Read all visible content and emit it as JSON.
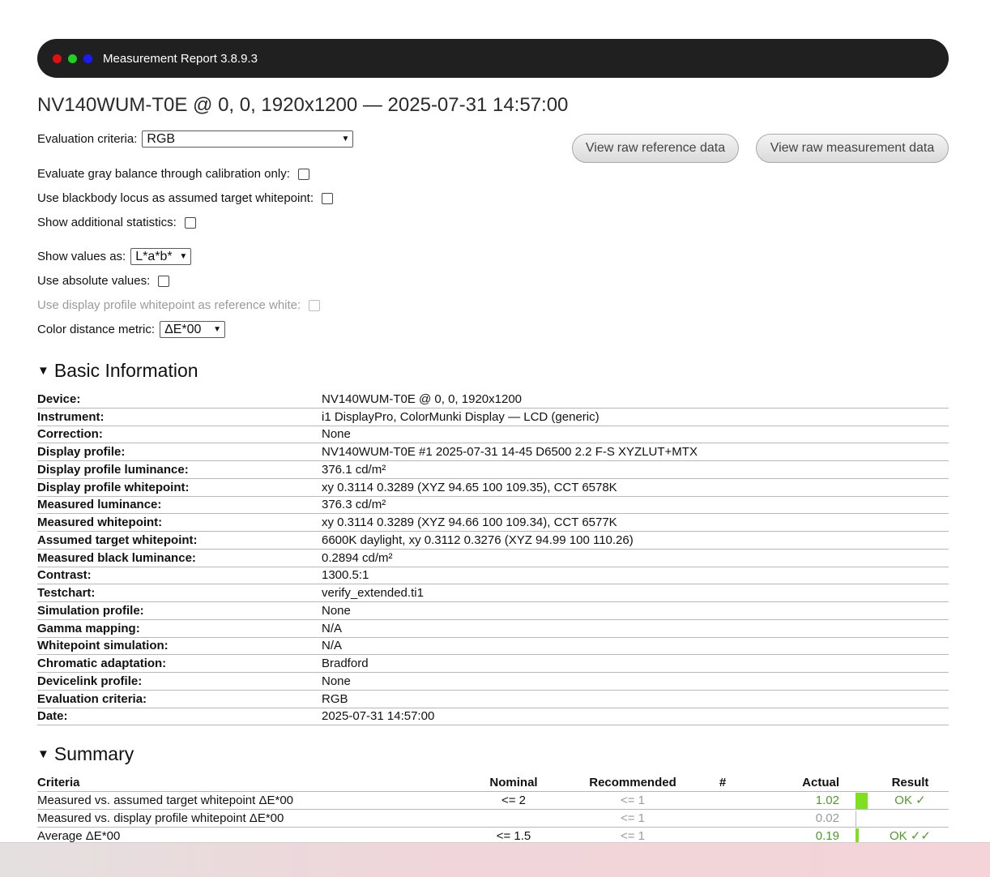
{
  "window": {
    "title": "Measurement Report 3.8.9.3",
    "dot_colors": [
      "#e01010",
      "#20d020",
      "#1a1aff"
    ]
  },
  "page_title": "NV140WUM-T0E @ 0, 0, 1920x1200 — 2025-07-31 14:57:00",
  "controls": {
    "evaluation_criteria": {
      "label": "Evaluation criteria:",
      "value": "RGB"
    },
    "gray_balance": {
      "label": "Evaluate gray balance through calibration only:"
    },
    "blackbody": {
      "label": "Use blackbody locus as assumed target whitepoint:"
    },
    "additional_stats": {
      "label": "Show additional statistics:"
    },
    "show_values": {
      "label": "Show values as:",
      "value": "L*a*b*"
    },
    "absolute_values": {
      "label": "Use absolute values:"
    },
    "profile_whitepoint": {
      "label": "Use display profile whitepoint as reference white:"
    },
    "distance_metric": {
      "label": "Color distance metric:",
      "value": "ΔE*00"
    }
  },
  "buttons": {
    "raw_reference": "View raw reference data",
    "raw_measurement": "View raw measurement data"
  },
  "basic_info": {
    "heading": "Basic Information",
    "rows": [
      {
        "label": "Device:",
        "value": "NV140WUM-T0E @ 0, 0, 1920x1200"
      },
      {
        "label": "Instrument:",
        "value": "i1 DisplayPro, ColorMunki Display — LCD (generic)"
      },
      {
        "label": "Correction:",
        "value": "None"
      },
      {
        "label": "Display profile:",
        "value": "NV140WUM-T0E #1 2025-07-31 14-45 D6500 2.2 F-S XYZLUT+MTX"
      },
      {
        "label": "Display profile luminance:",
        "value": "376.1 cd/m²"
      },
      {
        "label": "Display profile whitepoint:",
        "value": "xy 0.3114 0.3289 (XYZ 94.65 100 109.35), CCT 6578K"
      },
      {
        "label": "Measured luminance:",
        "value": "376.3 cd/m²"
      },
      {
        "label": "Measured whitepoint:",
        "value": "xy 0.3114 0.3289 (XYZ 94.66 100 109.34), CCT 6577K"
      },
      {
        "label": "Assumed target whitepoint:",
        "value": "6600K daylight, xy 0.3112 0.3276 (XYZ 94.99 100 110.26)"
      },
      {
        "label": "Measured black luminance:",
        "value": "0.2894 cd/m²"
      },
      {
        "label": "Contrast:",
        "value": "1300.5:1"
      },
      {
        "label": "Testchart:",
        "value": "verify_extended.ti1"
      },
      {
        "label": "Simulation profile:",
        "value": "None"
      },
      {
        "label": "Gamma mapping:",
        "value": "N/A"
      },
      {
        "label": "Whitepoint simulation:",
        "value": "N/A"
      },
      {
        "label": "Chromatic adaptation:",
        "value": "Bradford"
      },
      {
        "label": "Devicelink profile:",
        "value": "None"
      },
      {
        "label": "Evaluation criteria:",
        "value": "RGB"
      },
      {
        "label": "Date:",
        "value": "2025-07-31 14:57:00"
      }
    ]
  },
  "summary": {
    "heading": "Summary",
    "columns": {
      "criteria": "Criteria",
      "nominal": "Nominal",
      "recommended": "Recommended",
      "count": "#",
      "actual": "Actual",
      "result": "Result"
    },
    "rows": [
      {
        "criteria": "Measured vs. assumed target whitepoint ΔE*00",
        "nominal": "<= 2",
        "recommended": "<= 1",
        "count": "",
        "actual": "1.02",
        "result": "OK ✓",
        "bar_fraction": 0.51
      },
      {
        "criteria": "Measured vs. display profile whitepoint ΔE*00",
        "nominal": "",
        "recommended": "<= 1",
        "count": "",
        "actual": "0.02",
        "result": "",
        "bar_fraction": 0
      },
      {
        "criteria": "Average ΔE*00",
        "nominal": "<= 1.5",
        "recommended": "<= 1",
        "count": "",
        "actual": "0.19",
        "result": "OK ✓✓",
        "bar_fraction": 0.13
      }
    ],
    "bar_color": "#7ee020"
  }
}
